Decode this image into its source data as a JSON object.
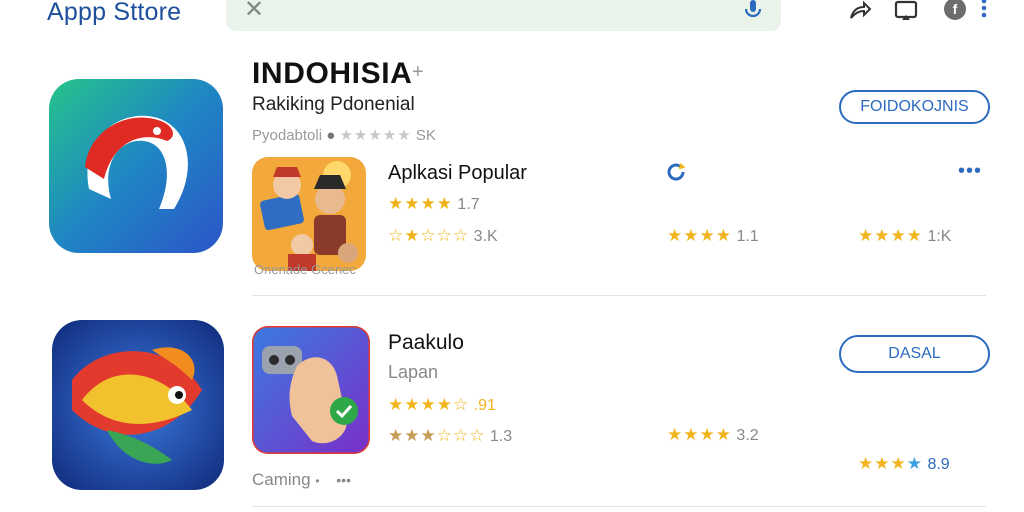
{
  "header": {
    "brand": "Appp Sttore",
    "close_glyph": "✕",
    "icons": [
      "mic-icon",
      "share-icon",
      "cast-icon",
      "account-icon",
      "more-vert-icon"
    ]
  },
  "colors": {
    "accent": "#2c6bbf",
    "brand": "#1d4f9c",
    "star": "#f2b41d",
    "search_bg": "#e9f3ea"
  },
  "section1": {
    "title": "INDOHISIA",
    "plus": "+",
    "subtitle": "Rakiking Pdonenial",
    "meta_label": "Pyodabtoli",
    "meta_count": "SK",
    "button": "FOIDOKOJNIS",
    "stars_rating": "★★★★★",
    "app": {
      "name": "Aplkasi Popular",
      "stars": "★★★★",
      "rating": "1.7",
      "stars2_filled": "☆★",
      "stars2_empty": "☆☆☆",
      "count": "3.K",
      "caption": "Onenade Gcenec",
      "mid_stars": "★★★",
      "mid_stars_empty": "★",
      "mid_rating": "1.1",
      "right_stars_empty": "★",
      "right_stars": "★★★",
      "right_count": "1:K",
      "more": "•••"
    }
  },
  "section2": {
    "button": "DASAL",
    "app": {
      "name": "Paakulo",
      "sub": "Lapan",
      "stars": "★★★★",
      "stars_empty": "☆",
      "rating": ".91",
      "stars2_filled": "★★★",
      "stars2_empty": "☆☆☆",
      "count": "1.3",
      "mid_stars": "★★★★",
      "mid_rating": "3.2",
      "right_stars_empty": "★",
      "right_stars": "★★",
      "right_stars_blue": "★",
      "right_count": "8.9",
      "category": "Caming",
      "bullet": "•",
      "more": "•••"
    }
  }
}
